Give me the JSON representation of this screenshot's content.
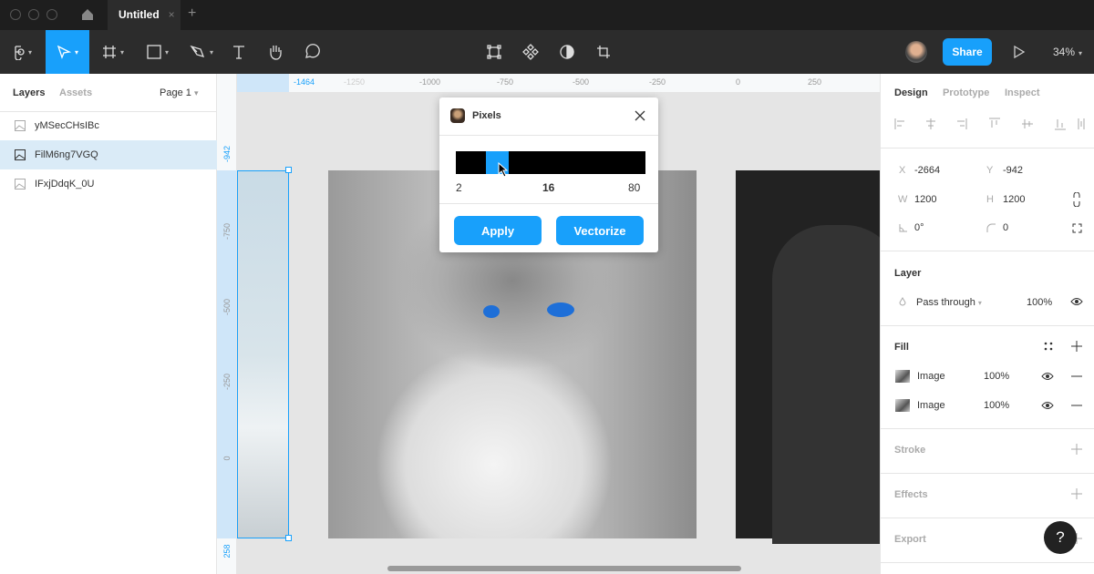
{
  "tabbar": {
    "doc_title": "Untitled",
    "close": "×",
    "new_tab": "+"
  },
  "toolbar": {
    "zoom": "34%",
    "share": "Share"
  },
  "left_panel": {
    "tabs": [
      "Layers",
      "Assets"
    ],
    "page": "Page 1",
    "layers": [
      {
        "name": "yMSecCHsIBc",
        "selected": false
      },
      {
        "name": "FilM6ng7VGQ",
        "selected": true
      },
      {
        "name": "IFxjDdqK_0U",
        "selected": false
      }
    ]
  },
  "rulers": {
    "h": [
      "-1464",
      "-1250",
      "-1000",
      "-750",
      "-500",
      "-250",
      "0",
      "250"
    ],
    "v": [
      "-942",
      "-750",
      "-500",
      "-250",
      "0",
      "258"
    ]
  },
  "plugin": {
    "title": "Pixels",
    "min": "2",
    "value": "16",
    "max": "80",
    "value_fraction": 0.18,
    "apply": "Apply",
    "vectorize": "Vectorize"
  },
  "right_panel": {
    "tabs": [
      "Design",
      "Prototype",
      "Inspect"
    ],
    "x_label": "X",
    "x": "-2664",
    "y_label": "Y",
    "y": "-942",
    "w_label": "W",
    "w": "1200",
    "h_label": "H",
    "h": "1200",
    "rotation": "0°",
    "radius": "0",
    "layer": {
      "title": "Layer",
      "blend": "Pass through",
      "opacity": "100%"
    },
    "fill": {
      "title": "Fill",
      "items": [
        {
          "type": "Image",
          "opacity": "100%"
        },
        {
          "type": "Image",
          "opacity": "100%"
        }
      ]
    },
    "stroke": "Stroke",
    "effects": "Effects",
    "export": "Export"
  },
  "help": "?",
  "colors": {
    "accent": "#18a0fb",
    "toolbar": "#2c2c2c"
  }
}
